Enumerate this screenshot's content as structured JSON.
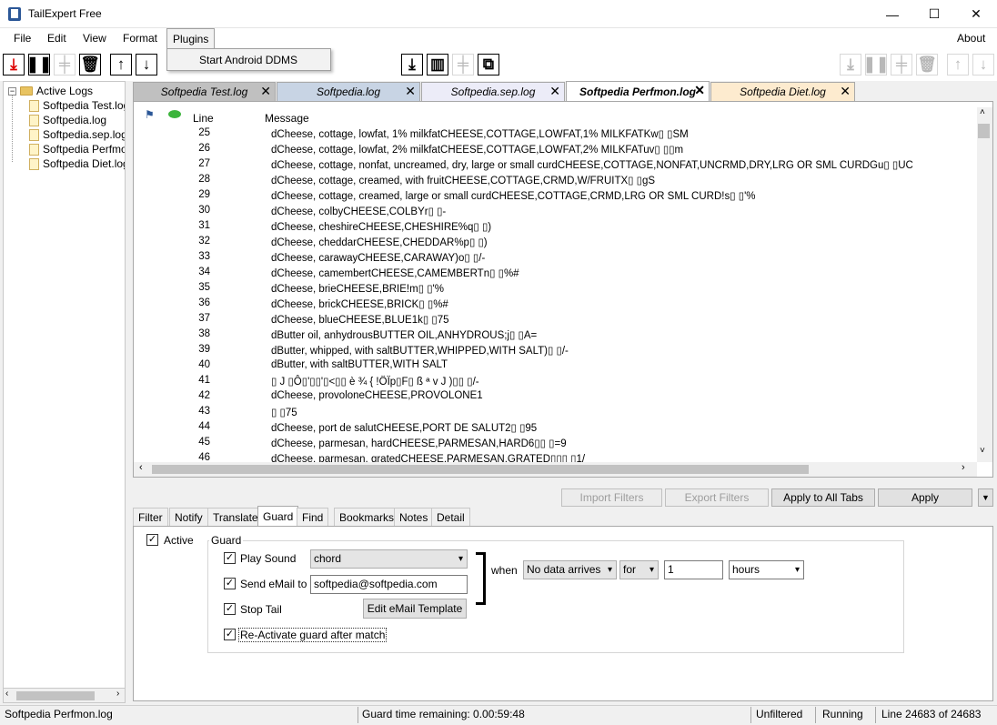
{
  "window": {
    "title": "TailExpert Free",
    "minimize": "—",
    "maximize": "☐",
    "close": "✕"
  },
  "menu": {
    "file": "File",
    "edit": "Edit",
    "view": "View",
    "format": "Format",
    "plugins": "Plugins",
    "about": "About"
  },
  "plugins_menu": {
    "item": "Start Android DDMS"
  },
  "toolbar_icons": [
    "tail-start-icon",
    "pause-icon",
    "add-icon",
    "delete-icon",
    "arrow-up-icon",
    "arrow-down-icon"
  ],
  "tree": {
    "root": "Active Logs",
    "items": [
      "Softpedia Test.log",
      "Softpedia.log",
      "Softpedia.sep.log",
      "Softpedia Perfmon.log",
      "Softpedia Diet.log"
    ]
  },
  "tabs": [
    {
      "label": "Softpedia Test.log",
      "color": "#c0c0c0"
    },
    {
      "label": "Softpedia.log",
      "color": "#c8d4e4"
    },
    {
      "label": "Softpedia.sep.log",
      "color": "#ececf8"
    },
    {
      "label": "Softpedia Perfmon.log",
      "color": "#ffffff"
    },
    {
      "label": "Softpedia Diet.log",
      "color": "#fdebcf"
    }
  ],
  "log": {
    "col_line": "Line",
    "col_message": "Message",
    "rows": [
      {
        "line": "25",
        "msg": "dCheese, cottage, lowfat, 1% milkfatCHEESE,COTTAGE,LOWFAT,1% MILKFATKw▯ ▯SM"
      },
      {
        "line": "26",
        "msg": "dCheese, cottage, lowfat, 2% milkfatCHEESE,COTTAGE,LOWFAT,2% MILKFATuv▯ ▯▯m"
      },
      {
        "line": "27",
        "msg": "dCheese, cottage, nonfat, uncreamed, dry, large or small curdCHEESE,COTTAGE,NONFAT,UNCRMD,DRY,LRG OR SML CURDGu▯ ▯UC"
      },
      {
        "line": "28",
        "msg": "dCheese, cottage, creamed, with fruitCHEESE,COTTAGE,CRMD,W/FRUITX▯ ▯gS"
      },
      {
        "line": "29",
        "msg": "dCheese, cottage, creamed, large or small curdCHEESE,COTTAGE,CRMD,LRG OR SML CURD!s▯ ▯'%"
      },
      {
        "line": "30",
        "msg": "dCheese, colbyCHEESE,COLBYr▯ ▯-"
      },
      {
        "line": "31",
        "msg": "dCheese, cheshireCHEESE,CHESHIRE%q▯ ▯)"
      },
      {
        "line": "32",
        "msg": "dCheese, cheddarCHEESE,CHEDDAR%p▯ ▯)"
      },
      {
        "line": "33",
        "msg": "dCheese, carawayCHEESE,CARAWAY)o▯ ▯/-"
      },
      {
        "line": "34",
        "msg": "dCheese, camembertCHEESE,CAMEMBERTn▯ ▯%#"
      },
      {
        "line": "35",
        "msg": "dCheese, brieCHEESE,BRIE!m▯ ▯'%"
      },
      {
        "line": "36",
        "msg": "dCheese, brickCHEESE,BRICK▯ ▯%#"
      },
      {
        "line": "37",
        "msg": "dCheese, blueCHEESE,BLUE1k▯ ▯75"
      },
      {
        "line": "38",
        "msg": "dButter oil, anhydrousBUTTER OIL,ANHYDROUS;j▯ ▯A="
      },
      {
        "line": "39",
        "msg": "dButter, whipped, with saltBUTTER,WHIPPED,WITH SALT)▯ ▯/-"
      },
      {
        "line": "40",
        "msg": "dButter, with saltBUTTER,WITH SALT"
      },
      {
        "line": "41",
        "msg": "    ▯ J ▯Ô▯'▯▯'▯<▯▯ è ¾ { !ÖÏp▯F▯ ß ª v J                                        )▯▯ ▯/-"
      },
      {
        "line": "42",
        "msg": "dCheese, provoloneCHEESE,PROVOLONE1"
      },
      {
        "line": "43",
        "msg": "▯ ▯75"
      },
      {
        "line": "44",
        "msg": "dCheese, port de salutCHEESE,PORT DE SALUT2▯ ▯95"
      },
      {
        "line": "45",
        "msg": "dCheese, parmesan, hardCHEESE,PARMESAN,HARD6▯▯ ▯=9"
      },
      {
        "line": "46",
        "msg": "dCheese, parmesan, gratedCHEESE,PARMESAN,GRATED▯▯▯ ▯1/"
      }
    ]
  },
  "actions": {
    "import": "Import Filters",
    "export": "Export Filters",
    "apply_all": "Apply to All Tabs",
    "apply": "Apply"
  },
  "bottom_tabs": [
    "Filter",
    "Notify",
    "Translate",
    "Guard",
    "Find",
    "Bookmarks",
    "Notes",
    "Detail"
  ],
  "guard": {
    "active_label": "Active",
    "group_label": "Guard",
    "play_sound_label": "Play Sound",
    "sound_value": "chord",
    "send_email_label": "Send eMail to",
    "email_value": "softpedia@softpedia.com",
    "stop_tail_label": "Stop Tail",
    "edit_template": "Edit eMail Template",
    "reactivate_label": "Re-Activate guard after match",
    "when_label": "when",
    "condition": "No data arrives",
    "for_label": "for",
    "amount": "1",
    "unit": "hours"
  },
  "status": {
    "file": "Softpedia Perfmon.log",
    "guard_time": "Guard time remaining: 0.00:59:48",
    "filter": "Unfiltered",
    "state": "Running",
    "line_info": "Line 24683 of 24683"
  }
}
